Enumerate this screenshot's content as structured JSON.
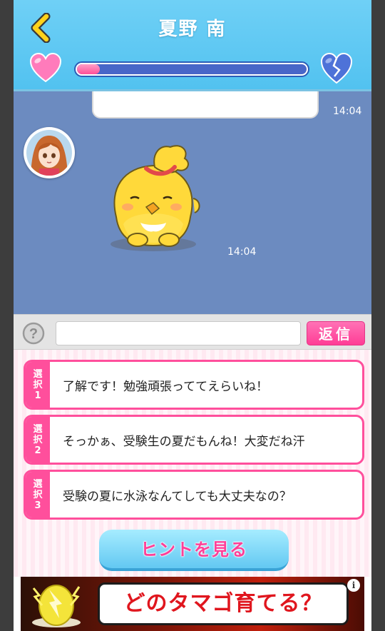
{
  "header": {
    "title": "夏野 南",
    "affection_progress": 0.1
  },
  "chat": {
    "messages": [
      {
        "type": "text",
        "time": "14:04"
      },
      {
        "type": "sticker",
        "sticker": "chick-sleeping-sticker",
        "time": "14:04"
      }
    ]
  },
  "input": {
    "placeholder": "",
    "send_label": "返信"
  },
  "choices": [
    {
      "tag": [
        "選",
        "択",
        "1"
      ],
      "text": "了解です！勉強頑張っててえらいね！"
    },
    {
      "tag": [
        "選",
        "択",
        "2"
      ],
      "text": "そっかぁ、受験生の夏だもんね！大変だね汗"
    },
    {
      "tag": [
        "選",
        "択",
        "3"
      ],
      "text": "受験の夏に水泳なんてしても大丈夫なの？"
    }
  ],
  "hint_button": "ヒントを見る",
  "ad": {
    "text": "どのタマゴ育てる？",
    "info": "i"
  },
  "colors": {
    "header": "#5ac6f2",
    "chat_bg": "#6c8bc0",
    "accent_pink": "#ff4f9c"
  }
}
